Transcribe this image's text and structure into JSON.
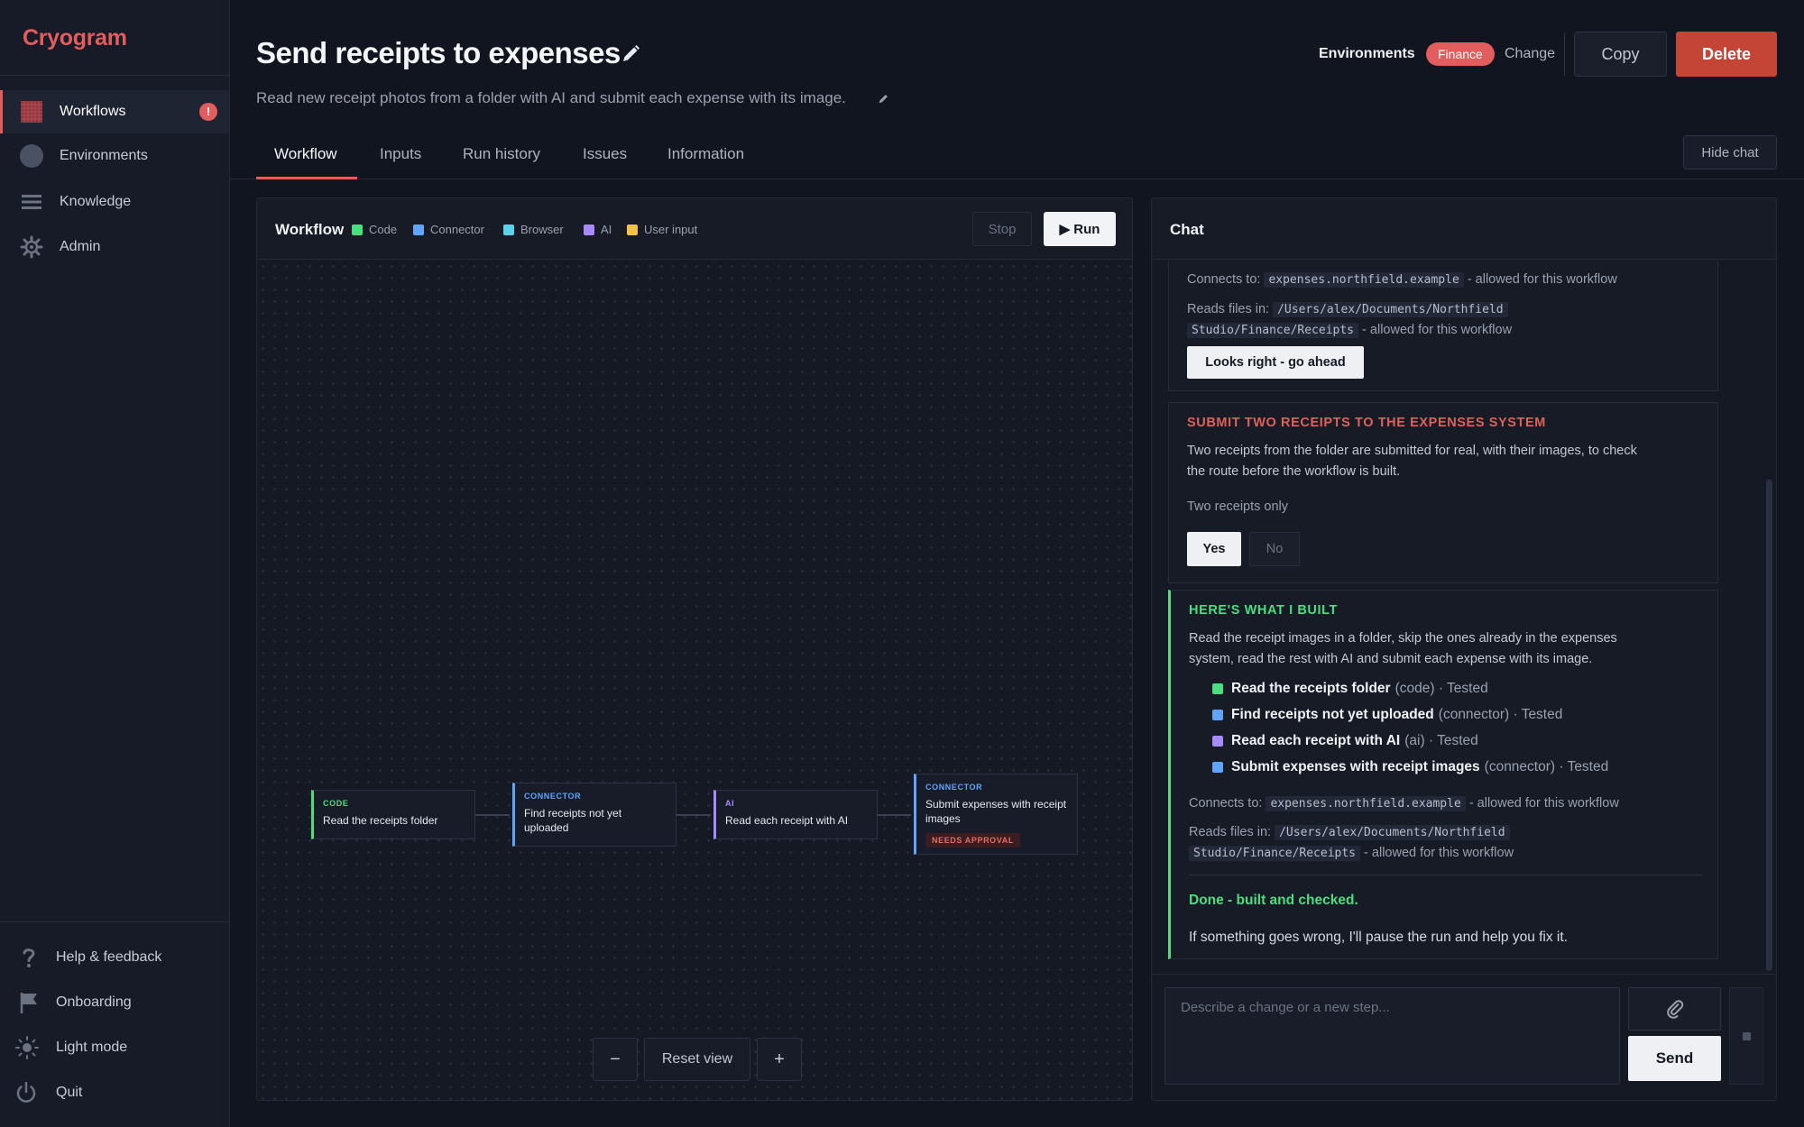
{
  "app": {
    "brand": "Cryogram"
  },
  "sidebar": {
    "items": [
      {
        "label": "Workflows",
        "icon": "grid-icon",
        "badge": "!"
      },
      {
        "label": "Environments",
        "icon": "circle-icon"
      },
      {
        "label": "Knowledge",
        "icon": "list-icon"
      },
      {
        "label": "Admin",
        "icon": "gear-icon"
      }
    ],
    "bottom_items": [
      {
        "label": "Help & feedback",
        "icon": "question-icon"
      },
      {
        "label": "Onboarding",
        "icon": "flag-icon"
      },
      {
        "label": "Light mode",
        "icon": "sun-icon"
      },
      {
        "label": "Quit",
        "icon": "power-icon"
      }
    ]
  },
  "header": {
    "title": "Send receipts to expenses",
    "subtitle": "Read new receipt photos from a folder with AI and submit each expense with its image.",
    "environments_label": "Environments",
    "environment": "Finance",
    "change_label": "Change",
    "copy_label": "Copy",
    "delete_label": "Delete"
  },
  "tabs": [
    "Workflow",
    "Inputs",
    "Run history",
    "Issues",
    "Information"
  ],
  "active_tab": "Workflow",
  "hide_chat_label": "Hide chat",
  "workflow": {
    "title": "Workflow",
    "legend": [
      {
        "label": "Code",
        "color": "#4ade80"
      },
      {
        "label": "Connector",
        "color": "#60a5fa"
      },
      {
        "label": "Browser",
        "color": "#5ed2e8"
      },
      {
        "label": "AI",
        "color": "#a78bfa"
      },
      {
        "label": "User input",
        "color": "#f5c04a"
      }
    ],
    "stop_label": "Stop",
    "run_label": "▶ Run",
    "nodes": [
      {
        "type": "CODE",
        "label": "Read the receipts folder",
        "color": "#4ade80"
      },
      {
        "type": "CONNECTOR",
        "label": "Find receipts not yet uploaded",
        "color": "#60a5fa"
      },
      {
        "type": "AI",
        "label": "Read each receipt with AI",
        "color": "#a78bfa"
      },
      {
        "type": "CONNECTOR",
        "label": "Submit expenses with receipt images",
        "color": "#60a5fa",
        "flag": "NEEDS APPROVAL"
      }
    ],
    "zoom_out_label": "−",
    "reset_view_label": "Reset view",
    "zoom_in_label": "+"
  },
  "chat": {
    "title": "Chat",
    "card1": {
      "connects_prefix": "Connects to:",
      "connects_host": "expenses.northfield.example",
      "connects_suffix": "- allowed for this workflow",
      "reads_prefix": "Reads files in:",
      "reads_path_1": "/Users/alex/Documents/Northfield",
      "reads_path_2": "Studio/Finance/Receipts",
      "reads_suffix": "- allowed for this workflow",
      "button": "Looks right - go ahead"
    },
    "card2": {
      "heading": "SUBMIT TWO RECEIPTS TO THE EXPENSES SYSTEM",
      "body_1": "Two receipts from the folder are submitted for real, with their images, to check",
      "body_2": "the route before the workflow is built.",
      "note": "Two receipts only",
      "yes": "Yes",
      "no": "No"
    },
    "card3": {
      "heading": "HERE'S WHAT I BUILT",
      "body_1": "Read the receipt images in a folder, skip the ones already in the expenses",
      "body_2": "system, read the rest with AI and submit each expense with its image.",
      "steps": [
        {
          "name": "Read the receipts folder",
          "kind": "(code)",
          "status": "· Tested",
          "color": "#4ade80"
        },
        {
          "name": "Find receipts not yet uploaded",
          "kind": "(connector)",
          "status": "· Tested",
          "color": "#60a5fa"
        },
        {
          "name": "Read each receipt with AI",
          "kind": "(ai)",
          "status": "· Tested",
          "color": "#a78bfa"
        },
        {
          "name": "Submit expenses with receipt images",
          "kind": "(connector)",
          "status": "· Tested",
          "color": "#60a5fa"
        }
      ],
      "connects_prefix": "Connects to:",
      "connects_host": "expenses.northfield.example",
      "connects_suffix": "- allowed for this workflow",
      "reads_prefix": "Reads files in:",
      "reads_path_1": "/Users/alex/Documents/Northfield",
      "reads_path_2": "Studio/Finance/Receipts",
      "reads_suffix": "- allowed for this workflow",
      "done": "Done - built and checked.",
      "footer": "If something goes wrong, I'll pause the run and help you fix it."
    },
    "input_placeholder": "Describe a change or a new step...",
    "send_label": "Send"
  },
  "colors": {
    "accent": "#e25d5d",
    "delete": "#c44536",
    "success": "#4ade80",
    "heading_red": "#e0605a"
  }
}
